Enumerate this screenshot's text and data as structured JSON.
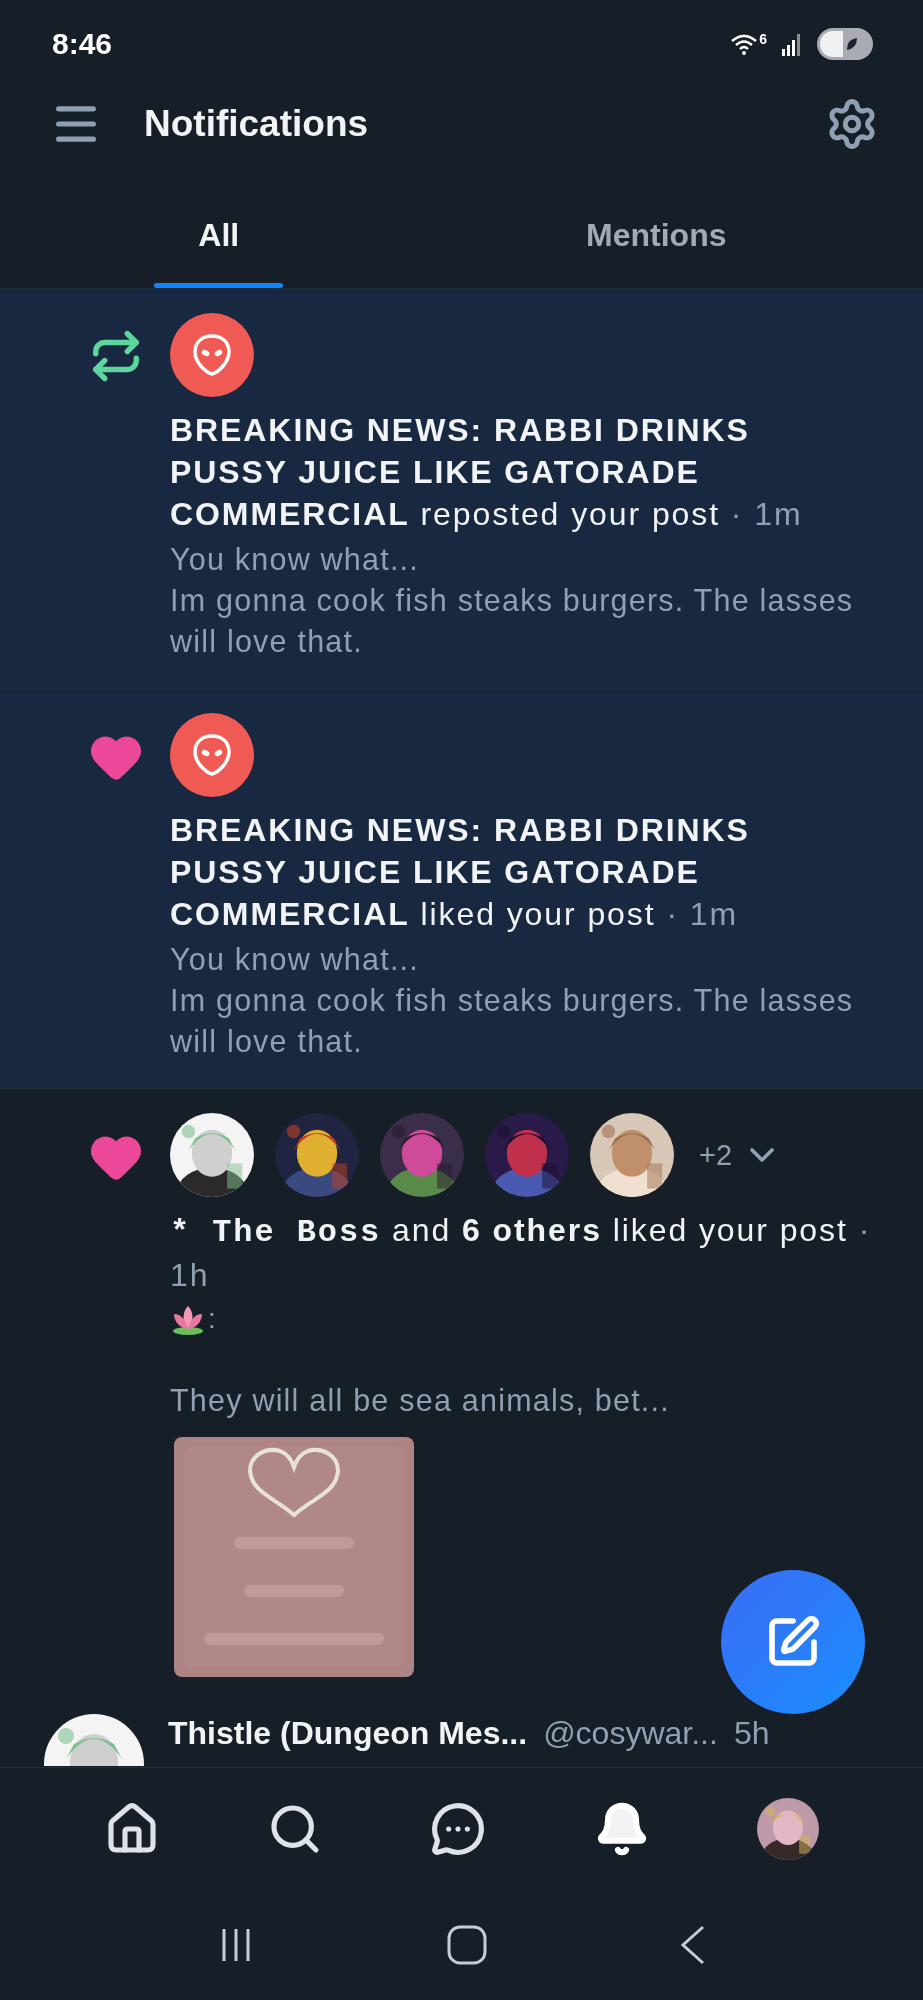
{
  "status_bar": {
    "time": "8:46",
    "wifi_label": "6"
  },
  "header": {
    "title": "Notifications"
  },
  "tabs": [
    {
      "label": "All",
      "selected": true
    },
    {
      "label": "Mentions",
      "selected": false
    }
  ],
  "notifications": [
    {
      "kind": "repost",
      "unread": true,
      "avatars": [
        {
          "kind": "default"
        }
      ],
      "actor": "BREAKING NEWS: RABBI DRINKS PUSSY JUICE LIKE GATORADE COMMERCIAL",
      "action": "reposted your post",
      "time": "· 1m",
      "post_text": "You know what...\nIm gonna cook fish steaks burgers. The lasses will love that."
    },
    {
      "kind": "like",
      "unread": true,
      "avatars": [
        {
          "kind": "default"
        }
      ],
      "actor": "BREAKING NEWS: RABBI DRINKS PUSSY JUICE LIKE GATORADE COMMERCIAL",
      "action": "liked your post",
      "time": "· 1m",
      "post_text": "You know what...\nIm gonna cook fish steaks burgers. The lasses will love that."
    },
    {
      "kind": "like",
      "unread": false,
      "more_count": "+2",
      "expanded": false,
      "actor": "* The Boss",
      "connector": "and",
      "others": "6 others",
      "action": "liked your post",
      "time": "· 1h",
      "emoji_line": {
        "kind": "lotus",
        "text": ":"
      },
      "post_text": "They will all be sea animals, bet..."
    }
  ],
  "post_preview": {
    "author": "Thistle (Dungeon Mes...",
    "handle": "@cosywar...",
    "time": "5h"
  },
  "bottom_nav": [
    {
      "kind": "home",
      "selected": false
    },
    {
      "kind": "search",
      "selected": false
    },
    {
      "kind": "chat",
      "selected": false
    },
    {
      "kind": "bell",
      "selected": true
    },
    {
      "kind": "profile",
      "selected": false
    }
  ]
}
